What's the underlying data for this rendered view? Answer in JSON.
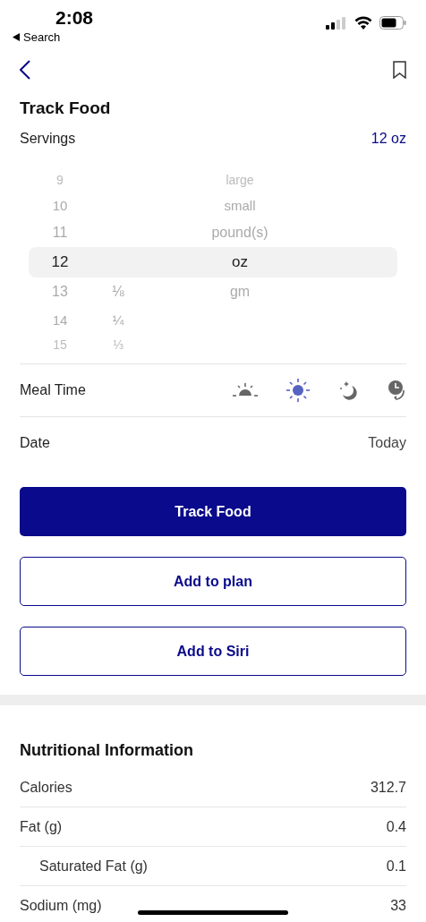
{
  "status_bar": {
    "time": "2:08",
    "back_label": "Search"
  },
  "title": "Track Food",
  "servings": {
    "label": "Servings",
    "value": "12 oz"
  },
  "picker": {
    "rows": [
      {
        "number": "9",
        "unit": "large",
        "selected": false
      },
      {
        "number": "10",
        "unit": "small",
        "selected": false
      },
      {
        "number": "11",
        "unit": "pound(s)",
        "selected": false
      },
      {
        "number": "12",
        "unit": "oz",
        "selected": true
      },
      {
        "number": "13",
        "fraction": "⅛",
        "unit": "gm",
        "selected": false
      },
      {
        "number": "14",
        "fraction": "¼",
        "selected": false
      },
      {
        "number": "15",
        "fraction": "⅓",
        "selected": false
      }
    ]
  },
  "meal_time": {
    "label": "Meal Time",
    "options": [
      {
        "kind": "sunrise",
        "selected": false
      },
      {
        "kind": "sun",
        "selected": true
      },
      {
        "kind": "moon",
        "selected": false
      },
      {
        "kind": "clock",
        "selected": false
      }
    ]
  },
  "date": {
    "label": "Date",
    "value": "Today"
  },
  "buttons": [
    {
      "label": "Track Food",
      "kind": "primary"
    },
    {
      "label": "Add to plan",
      "kind": "outline"
    },
    {
      "label": "Add to Siri",
      "kind": "outline"
    }
  ],
  "nutrition": {
    "title": "Nutritional Information",
    "rows": [
      {
        "label": "Calories",
        "value": "312.7"
      },
      {
        "label": "Fat (g)",
        "value": "0.4",
        "children": [
          {
            "label": "Saturated Fat (g)",
            "value": "0.1"
          }
        ]
      },
      {
        "label": "Sodium (mg)",
        "value": "33"
      }
    ]
  }
}
